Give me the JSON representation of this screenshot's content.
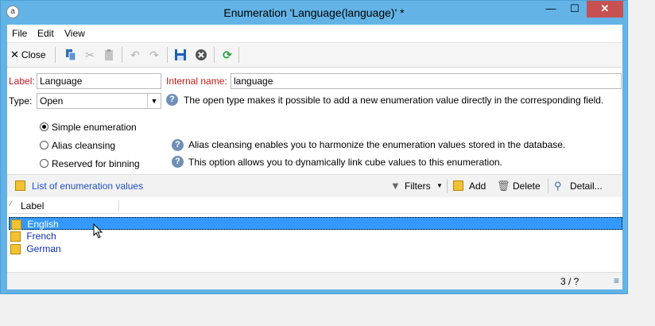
{
  "window": {
    "title": "Enumeration 'Language(language)' *",
    "app_icon_glyph": "a",
    "min_glyph": "—",
    "max_glyph": "☐",
    "close_glyph": "✕"
  },
  "menu": [
    "File",
    "Edit",
    "View"
  ],
  "toolbar": {
    "close_label": "Close"
  },
  "form": {
    "label_caption": "Label:",
    "label_value": "Language",
    "internal_caption": "Internal name:",
    "internal_value": "language",
    "type_caption": "Type:",
    "type_value": "Open",
    "type_help": "The open type makes it possible to add a new enumeration value directly in the corresponding field.",
    "radios": [
      {
        "label": "Simple enumeration",
        "checked": true
      },
      {
        "label": "Alias cleansing",
        "checked": false
      },
      {
        "label": "Reserved for binning",
        "checked": false
      }
    ],
    "alias_help": "Alias cleansing enables you to harmonize the enumeration values stored in the database.",
    "binning_help": "This option allows you to dynamically link cube values to this enumeration."
  },
  "list": {
    "title": "List of enumeration values",
    "filters_label": "Filters",
    "add_label": "Add",
    "delete_label": "Delete",
    "detail_label": "Detail...",
    "column_label": "Label",
    "rows": [
      "English",
      "French",
      "German"
    ],
    "selected_index": 0,
    "count": "3 / ?"
  },
  "colors": {
    "titlebar": "#63b3e6",
    "selection": "#3399ff",
    "required_label": "#c8161d",
    "link": "#0d2fb6"
  }
}
